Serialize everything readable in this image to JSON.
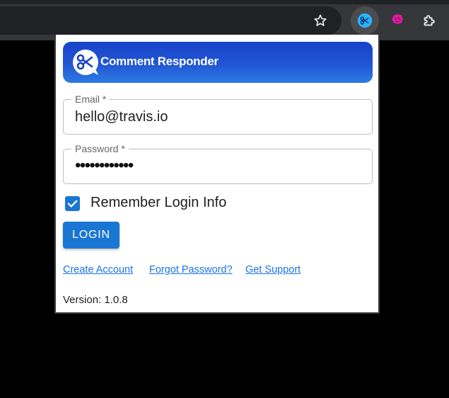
{
  "browser": {
    "icons": {
      "star": "star-icon",
      "active_extension": "scissors-chat-icon",
      "brain_extension": "brain-icon",
      "extensions": "puzzle-icon"
    },
    "colors": {
      "toolbar": "#35363a",
      "omnibox": "#202124"
    }
  },
  "popup": {
    "banner": {
      "title": "Comment Responder",
      "logo": "scissors-chat-logo"
    },
    "email": {
      "label": "Email *",
      "value": "hello@travis.io"
    },
    "password": {
      "label": "Password *",
      "value": "••••••••••••"
    },
    "remember": {
      "label": "Remember Login Info",
      "checked": true
    },
    "login_button": "LOGIN",
    "links": {
      "create": "Create Account",
      "forgot": "Forgot Password?",
      "support": "Get Support"
    },
    "version": "Version: 1.0.8",
    "colors": {
      "primary": "#1976d2",
      "link": "#1a73e8",
      "banner_start": "#1843c8",
      "banner_end": "#2c7be3"
    }
  }
}
